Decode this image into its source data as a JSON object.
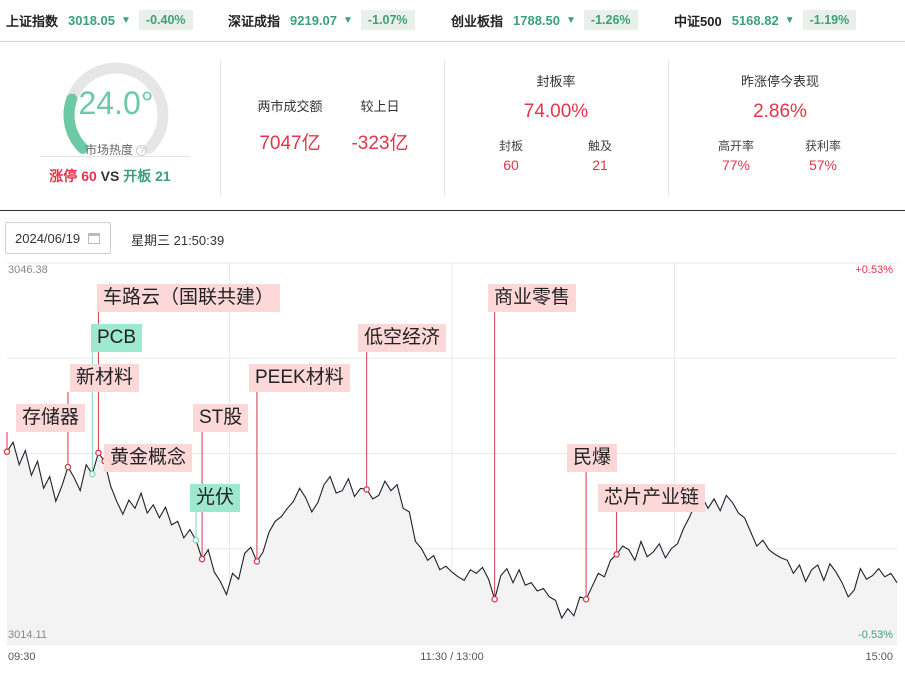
{
  "indices": [
    {
      "name": "上证指数",
      "value": "3018.05",
      "arrow": "▼",
      "change": "-0.40%"
    },
    {
      "name": "深证成指",
      "value": "9219.07",
      "arrow": "▼",
      "change": "-1.07%"
    },
    {
      "name": "创业板指",
      "value": "1788.50",
      "arrow": "▼",
      "change": "-1.26%"
    },
    {
      "name": "中证500",
      "value": "5168.82",
      "arrow": "▼",
      "change": "-1.19%"
    }
  ],
  "heat": {
    "value": "24.0°",
    "level": 0.24,
    "label": "市场热度",
    "help": "?",
    "limit_up_label": "涨停",
    "limit_up_count": "60",
    "vs": "VS",
    "open_board_label": "开板",
    "open_board_count": "21"
  },
  "turnover": {
    "label": "两市成交额",
    "value": "7047亿",
    "prev_label": "较上日",
    "prev_value": "-323亿"
  },
  "seal": {
    "title": "封板率",
    "rate": "74.00%",
    "sealed_label": "封板",
    "sealed_value": "60",
    "touched_label": "触及",
    "touched_value": "21"
  },
  "yesterday": {
    "title": "昨涨停今表现",
    "value": "2.86%",
    "high_open_label": "高开率",
    "high_open_value": "77%",
    "profit_label": "获利率",
    "profit_value": "57%"
  },
  "date": "2024/06/19",
  "datetime": "星期三 21:50:39",
  "chart_data": {
    "type": "line",
    "y_top_label": "3046.38",
    "y_bottom_label": "3014.11",
    "right_top_label": "+0.53%",
    "right_bottom_label": "-0.53%",
    "x_labels": [
      "09:30",
      "11:30 / 13:00",
      "15:00"
    ],
    "ylim": [
      3014.11,
      3046.38
    ],
    "series": [
      {
        "values": [
          3030.4,
          3031.2,
          3029.3,
          3030.5,
          3028.4,
          3029.6,
          3027.3,
          3028.3,
          3026.2,
          3027.5,
          3029.1,
          3028.2,
          3027.1,
          3029.3,
          3028.5,
          3030.3,
          3029.6,
          3027.5,
          3026.2,
          3025.1,
          3026.3,
          3025.6,
          3026.9,
          3025.2,
          3025.9,
          3024.8,
          3025.7,
          3024.2,
          3024.5,
          3023.1,
          3023.8,
          3022.9,
          3021.3,
          3022.1,
          3020.2,
          3019.4,
          3018.3,
          3020.1,
          3019.6,
          3021.8,
          3022.3,
          3021.1,
          3021.9,
          3023.6,
          3024.5,
          3024.9,
          3025.6,
          3026.2,
          3027.3,
          3026.5,
          3025.3,
          3026.1,
          3027.6,
          3028.3,
          3026.9,
          3027.1,
          3028.1,
          3026.6,
          3027.3,
          3027.2,
          3026.4,
          3026.7,
          3027.9,
          3027.1,
          3027.6,
          3025.6,
          3025.3,
          3022.8,
          3022.2,
          3021.2,
          3021.6,
          3020.4,
          3020.7,
          3020.2,
          3019.8,
          3019.5,
          3020.4,
          3020.1,
          3020.6,
          3019.6,
          3017.9,
          3019.9,
          3020.5,
          3019.3,
          3020.4,
          3019.1,
          3019.3,
          3018.6,
          3018.8,
          3018.1,
          3017.8,
          3016.3,
          3017.1,
          3016.5,
          3018.1,
          3017.9,
          3019.0,
          3020.1,
          3019.8,
          3021.2,
          3021.7,
          3022.4,
          3022.1,
          3021.2,
          3022.8,
          3021.5,
          3021.9,
          3022.6,
          3021.4,
          3022.2,
          3022.6,
          3023.9,
          3024.9,
          3026.1,
          3026.6,
          3025.6,
          3026.4,
          3025.4,
          3026.7,
          3026.1,
          3025.2,
          3024.8,
          3023.6,
          3022.4,
          3022.9,
          3022.1,
          3021.7,
          3021.4,
          3021.2,
          3020.1,
          3020.8,
          3019.4,
          3020.4,
          3020.8,
          3019.5,
          3020.9,
          3020.2,
          3019.3,
          3018.1,
          3018.7,
          3020.5,
          3019.6,
          3019.9,
          3020.5,
          3019.8,
          3020.1,
          3019.3
        ]
      }
    ],
    "events": [
      {
        "label": "存储器",
        "style": "down",
        "point_index": 0
      },
      {
        "label": "新材料",
        "style": "down",
        "point_index": 10
      },
      {
        "label": "PCB",
        "style": "up",
        "point_index": 14
      },
      {
        "label": "车路云（国联共建）",
        "style": "down",
        "point_index": 15
      },
      {
        "label": "黄金概念",
        "style": "down",
        "point_index": 16
      },
      {
        "label": "光伏",
        "style": "up",
        "point_index": 31
      },
      {
        "label": "ST股",
        "style": "down",
        "point_index": 32
      },
      {
        "label": "PEEK材料",
        "style": "down",
        "point_index": 41
      },
      {
        "label": "低空经济",
        "style": "down",
        "point_index": 59
      },
      {
        "label": "商业零售",
        "style": "down",
        "point_index": 80
      },
      {
        "label": "民爆",
        "style": "down",
        "point_index": 95
      },
      {
        "label": "芯片产业链",
        "style": "down",
        "point_index": 100
      }
    ]
  },
  "colors": {
    "red": "#e5344c",
    "green": "#3ea07a",
    "tag_red": "#fdd8d8",
    "tag_green": "#9ee8cf",
    "gauge": "#6cc9a5"
  }
}
